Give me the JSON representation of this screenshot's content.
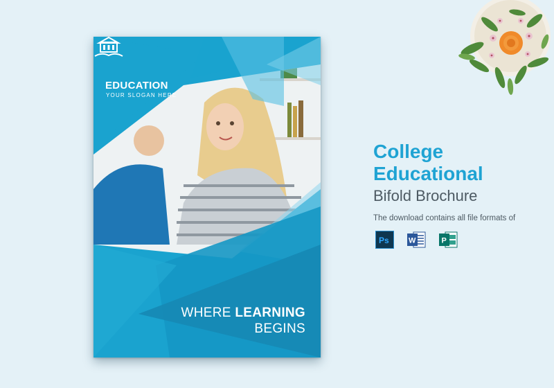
{
  "brochure": {
    "brand_title": "EDUCATION",
    "slogan": "YOUR SLOGAN HERE",
    "tagline_prefix": "WHERE",
    "tagline_bold": "LEARNING",
    "tagline_line2": "BEGINS",
    "photo_subject": "smiling-students-photo"
  },
  "product": {
    "title_line1": "College",
    "title_line2": "Educational",
    "subtitle": "Bifold Brochure",
    "formats_text": "The download contains all file formats of",
    "formats": [
      {
        "name": "photoshop-icon",
        "label": "Ps",
        "color": "#0f3750",
        "accent": "#31a8ff"
      },
      {
        "name": "word-icon",
        "label": "W",
        "color": "#2b579a",
        "accent": "#ffffff"
      },
      {
        "name": "publisher-icon",
        "label": "P",
        "color": "#077568",
        "accent": "#ffffff"
      }
    ]
  },
  "colors": {
    "background": "#e4f1f7",
    "brochure_blue": "#1aa3cf",
    "headline_blue": "#1fa3d3",
    "body_text": "#4d5a63"
  }
}
